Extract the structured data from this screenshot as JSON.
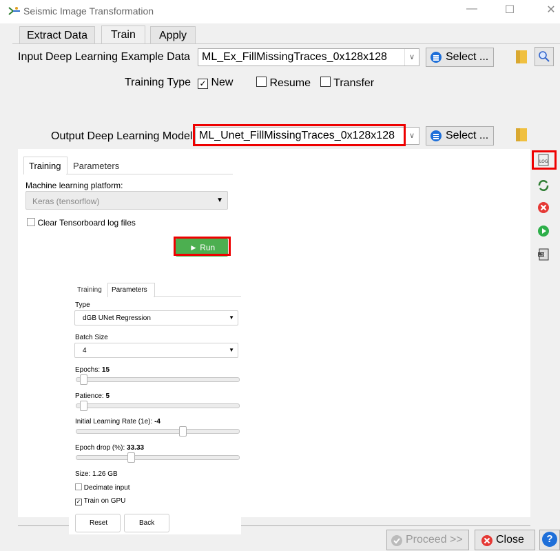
{
  "window": {
    "title": "Seismic Image Transformation",
    "minimize": "—",
    "maximize": "☐",
    "close": "✕"
  },
  "main_tabs": [
    "Extract Data",
    "Train",
    "Apply"
  ],
  "input": {
    "label": "Input Deep Learning Example Data",
    "value": "ML_Ex_FillMissingTraces_0x128x128",
    "select_label": "Select ..."
  },
  "training_type": {
    "label": "Training Type",
    "options": [
      "New",
      "Resume",
      "Transfer"
    ],
    "checked": "New"
  },
  "output": {
    "label": "Output Deep Learning Model",
    "value": "ML_Unet_FillMissingTraces_0x128x128",
    "select_label": "Select ..."
  },
  "panel": {
    "tabs": [
      "Training",
      "Parameters"
    ],
    "platform_label": "Machine learning platform:",
    "platform_value": "Keras (tensorflow)",
    "clear_logs_label": "Clear Tensorboard log files",
    "run_label": "► Run"
  },
  "params": {
    "tabs": [
      "Training",
      "Parameters"
    ],
    "type_label": "Type",
    "type_value": "dGB UNet Regression",
    "batch_label": "Batch Size",
    "batch_value": "4",
    "epochs_label": "Epochs:",
    "epochs_value": "15",
    "patience_label": "Patience:",
    "patience_value": "5",
    "lr_label": "Initial Learning Rate (1e):",
    "lr_value": "-4",
    "drop_label": "Epoch drop (%):",
    "drop_value": "33.33",
    "size_text": "Size: 1.26 GB",
    "decimate_label": "Decimate input",
    "gpu_label": "Train on GPU",
    "reset_label": "Reset",
    "back_label": "Back"
  },
  "sliders": {
    "epochs": 0.02,
    "patience": 0.02,
    "lr": 0.66,
    "drop": 0.33
  },
  "footer": {
    "proceed_label": "Proceed >>",
    "close_label": "Close",
    "help_label": "?"
  },
  "colors": {
    "accent": "#1e6fd9",
    "run_green": "#4caf50",
    "highlight_red": "#e00000",
    "close_red": "#e53935"
  }
}
